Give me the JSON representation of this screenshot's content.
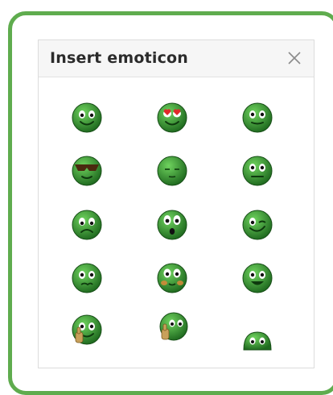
{
  "dialog": {
    "title": "Insert emoticon",
    "close_icon": "close-x-icon"
  },
  "colors": {
    "frame": "#5fac4e",
    "face_light": "#6fd35e",
    "face_dark": "#1f6a1f",
    "eye_white": "#ffffff",
    "pupil": "#111111",
    "heart": "#e02a2a",
    "sunglasses": "#4a2a0f",
    "thumb": "#c8a05a"
  },
  "emoticons": [
    {
      "icon": "smile-icon"
    },
    {
      "icon": "heart-eyes-icon"
    },
    {
      "icon": "neutral-smile-icon"
    },
    {
      "icon": "sunglasses-icon"
    },
    {
      "icon": "sleepy-icon"
    },
    {
      "icon": "neutral-face-icon"
    },
    {
      "icon": "sad-icon"
    },
    {
      "icon": "surprised-icon"
    },
    {
      "icon": "wink-icon"
    },
    {
      "icon": "worried-icon"
    },
    {
      "icon": "blushing-icon"
    },
    {
      "icon": "grin-icon"
    },
    {
      "icon": "thumbs-up-icon"
    },
    {
      "icon": "thumbs-up-side-icon"
    },
    {
      "icon": "peeking-icon"
    }
  ]
}
